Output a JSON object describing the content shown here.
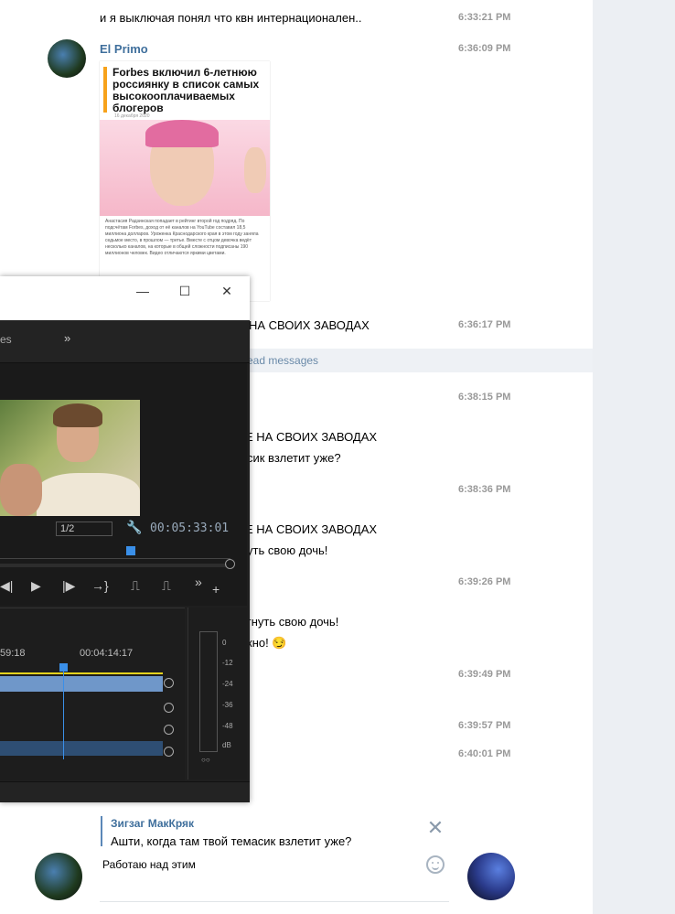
{
  "messages": {
    "m1_text": "и я выключая понял что квн интернационален..",
    "m1_time": "6:33:21 PM",
    "m2_sender": "El Primo",
    "m2_time": "6:36:09 PM",
    "m3_text": "НА СВОИХ ЗАВОДАХ",
    "m3_time": "6:36:17 PM",
    "unread": "ead messages",
    "m4_time": "6:38:15 PM",
    "m5_text": "Е НА СВОИХ ЗАВОДАХ",
    "m6_text": "сик взлетит уже?",
    "m7_time": "6:38:36 PM",
    "m8_text": "Е НА СВОИХ ЗАВОДАХ",
    "m9_text": "уть свою дочь!",
    "m10_time": "6:39:26 PM",
    "m11_text": "гнуть свою дочь!",
    "m12_text": "кно!",
    "m13_time": "6:39:49 PM",
    "m14_time": "6:39:57 PM",
    "m15_time": "6:40:01 PM"
  },
  "card": {
    "headline": "Forbes включил 6-летнюю россиянку в список самых высокооплачиваемых блогеров",
    "date": "16 декабря 2020",
    "body": "Анастасия Радзинская попадает в рейтинг второй год подряд. По подсчётам Forbes, доход от её каналов на YouTube составил 18,5 миллиона долларов. Уроженка Краснодарского края в этом году заняла седьмое место, в прошлом — третье. Вместе с отцом девочка ведёт несколько каналов, на которые в общей сложности подписаны 190 миллионов человек. Видео отличаются яркими цветами."
  },
  "reply": {
    "name": "Зигзаг МакКряк",
    "text": "Ашти, когда там твой темасик взлетит уже?",
    "input_value": "Работаю над этим"
  },
  "premiere": {
    "tab_label": "es",
    "more": "»",
    "zoom": "1/2",
    "timecode": "00:05:33:01",
    "tl_time1": "59:18",
    "tl_time2": "00:04:14:17",
    "db_labels": [
      "0",
      "-12",
      "-24",
      "-36",
      "-48",
      "dB"
    ],
    "meter_bottom": "○○"
  },
  "icons": {
    "close": "✕",
    "minimize": "—",
    "maximize": "☐",
    "wrench": "🔧",
    "emoji_smirk": "😏"
  },
  "colors": {
    "accent_link": "#3f6f9c",
    "timecode": "#9ab",
    "playhead": "#3a8fe8"
  }
}
